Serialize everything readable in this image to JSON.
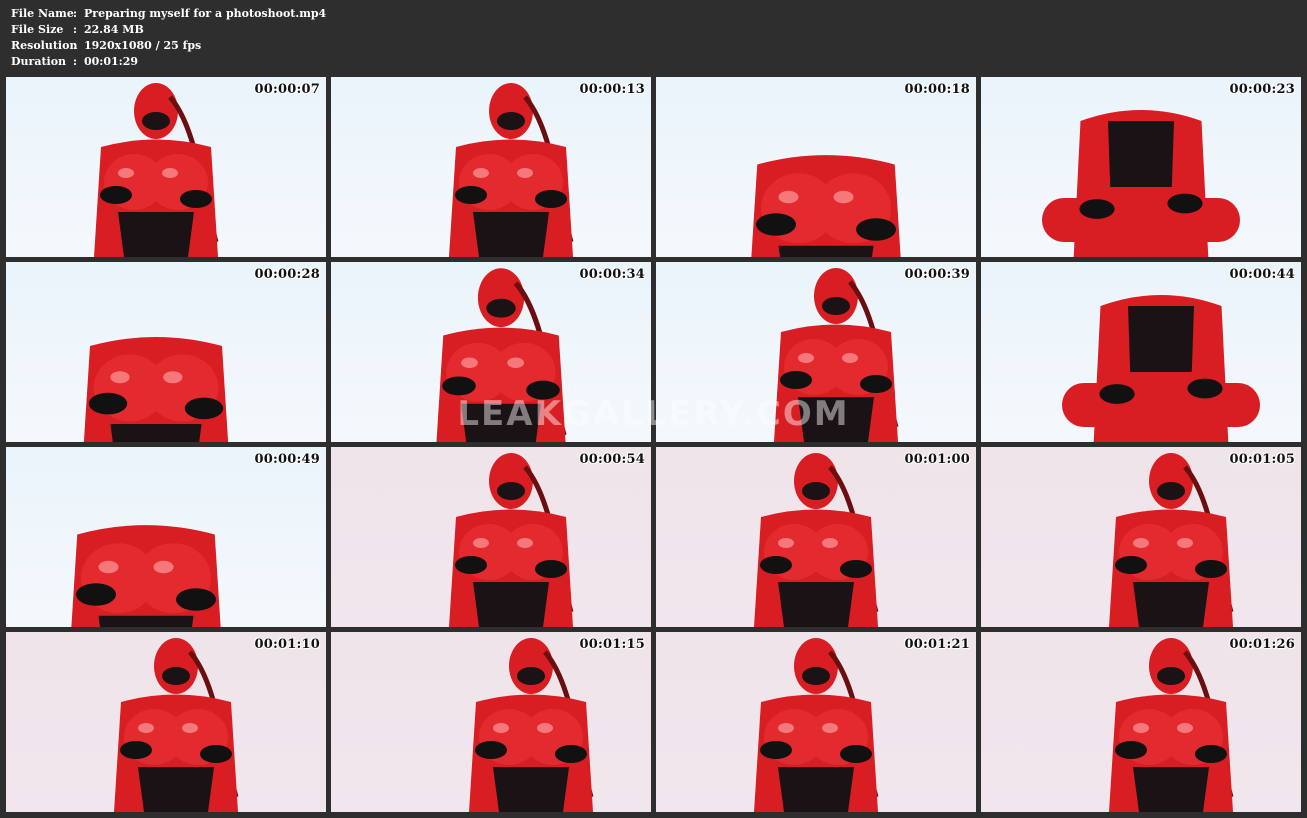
{
  "header": {
    "rows": [
      {
        "label": "File Name",
        "sep": ":",
        "value": "Preparing myself for a photoshoot.mp4"
      },
      {
        "label": "File Size",
        "sep": ":",
        "value": "22.84 MB"
      },
      {
        "label": "Resolution",
        "sep": ":",
        "value": "1920x1080 / 25 fps"
      },
      {
        "label": "Duration",
        "sep": ":",
        "value": "00:01:29"
      }
    ]
  },
  "thumbnails": [
    {
      "timestamp": "00:00:07",
      "bg": "blue"
    },
    {
      "timestamp": "00:00:13",
      "bg": "blue"
    },
    {
      "timestamp": "00:00:18",
      "bg": "blue"
    },
    {
      "timestamp": "00:00:23",
      "bg": "blue"
    },
    {
      "timestamp": "00:00:28",
      "bg": "blue"
    },
    {
      "timestamp": "00:00:34",
      "bg": "blue"
    },
    {
      "timestamp": "00:00:39",
      "bg": "blue"
    },
    {
      "timestamp": "00:00:44",
      "bg": "blue"
    },
    {
      "timestamp": "00:00:49",
      "bg": "blue"
    },
    {
      "timestamp": "00:00:54",
      "bg": "pink"
    },
    {
      "timestamp": "00:01:00",
      "bg": "pink"
    },
    {
      "timestamp": "00:01:05",
      "bg": "pink"
    },
    {
      "timestamp": "00:01:10",
      "bg": "pink"
    },
    {
      "timestamp": "00:01:15",
      "bg": "pink"
    },
    {
      "timestamp": "00:01:21",
      "bg": "pink"
    },
    {
      "timestamp": "00:01:26",
      "bg": "pink"
    }
  ],
  "watermark": "LEAKGALLERY.COM",
  "colors": {
    "background": "#2e2e2e",
    "suit": "#d81e22",
    "corset": "#1a1214"
  }
}
